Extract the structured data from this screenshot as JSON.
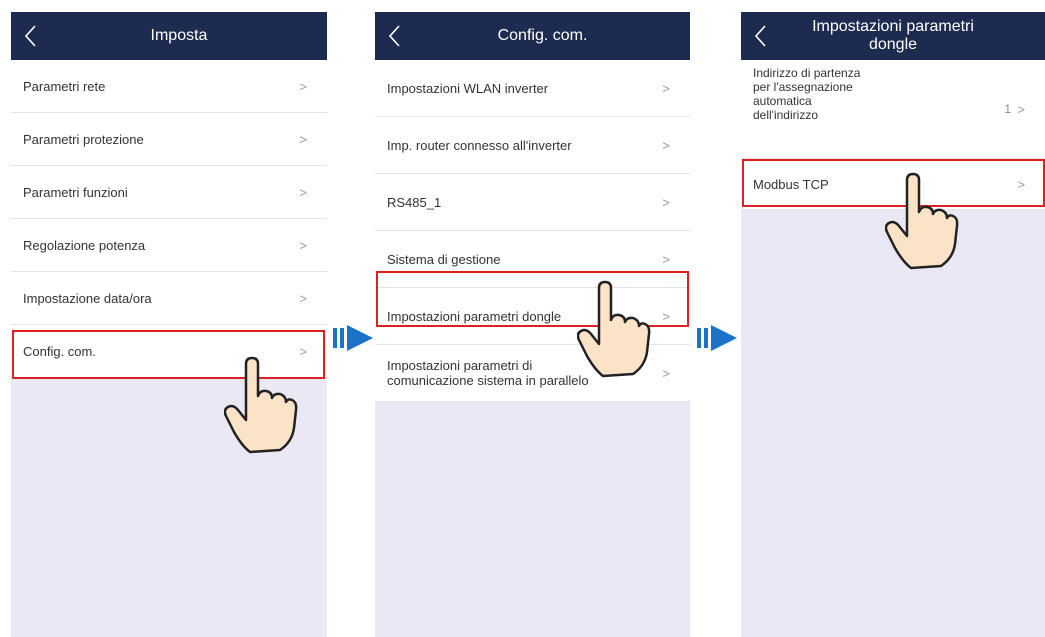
{
  "screens": [
    {
      "title": "Imposta",
      "items": [
        {
          "label": "Parametri rete"
        },
        {
          "label": "Parametri protezione"
        },
        {
          "label": "Parametri funzioni"
        },
        {
          "label": "Regolazione potenza"
        },
        {
          "label": "Impostazione data/ora"
        },
        {
          "label": "Config. com."
        }
      ],
      "highlighted_item": "Config. com."
    },
    {
      "title": "Config. com.",
      "items": [
        {
          "label": "Impostazioni WLAN inverter"
        },
        {
          "label": "Imp. router connesso all'inverter"
        },
        {
          "label": "RS485_1"
        },
        {
          "label": "Sistema di gestione"
        },
        {
          "label": "Impostazioni parametri dongle"
        },
        {
          "label": "Impostazioni parametri di comunicazione sistema in parallelo"
        }
      ],
      "highlighted_item": "Impostazioni parametri dongle"
    },
    {
      "title": "Impostazioni parametri dongle",
      "items": [
        {
          "label": "Indirizzo di partenza per l'assegnazione automatica dell'indirizzo",
          "value": "1"
        },
        {
          "label": "Modbus TCP"
        }
      ],
      "highlighted_item": "Modbus TCP"
    }
  ],
  "colors": {
    "header": "#1c2b4f",
    "highlight": "#e02020",
    "arrow": "#1a73c8",
    "background": "#ebe8f5"
  },
  "icons": {
    "back": "chevron-left-icon",
    "row": "chevron-right-icon",
    "pointer": "pointing-hand-icon",
    "next": "double-arrow-right-icon"
  }
}
